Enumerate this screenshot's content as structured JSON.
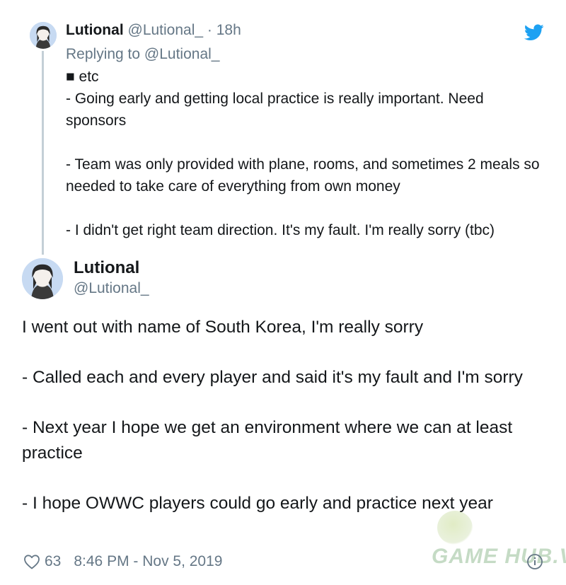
{
  "parent_tweet": {
    "name": "Lutional",
    "handle": "@Lutional_",
    "separator": "·",
    "time": "18h",
    "replying_prefix": "Replying to",
    "replying_to": "@Lutional_",
    "lines": [
      "■ etc",
      "- Going early and getting local practice is really important. Need sponsors",
      "",
      "- Team was only provided with plane, rooms, and sometimes 2 meals so needed to take care of everything from own money",
      "",
      "- I didn't get right team direction. It's my fault. I'm really sorry (tbc)"
    ]
  },
  "main_tweet": {
    "name": "Lutional",
    "handle": "@Lutional_",
    "paragraphs": [
      "I went out with name of South Korea, I'm really sorry",
      "- Called each and every player and said it's my fault and I'm sorry",
      "- Next year I hope we get an environment where we can at least practice",
      "- I hope OWWC players could go early and practice next year"
    ],
    "likes": "63",
    "timestamp": "8:46 PM - Nov 5, 2019"
  },
  "watermark": "GAME HUB.VN",
  "colors": {
    "twitter_blue": "#1da1f2",
    "secondary_text": "#657786",
    "thread_line": "#c4cfd6"
  },
  "icons": {
    "brand": "twitter-bird-icon",
    "like": "heart-icon",
    "info": "info-icon"
  }
}
